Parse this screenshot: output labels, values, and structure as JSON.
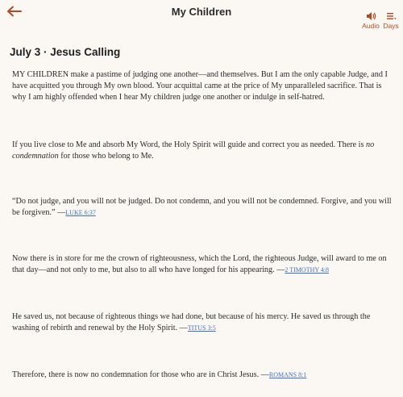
{
  "header": {
    "title": "My Children",
    "audio_label": "Audio",
    "days_label": "Days",
    "accent_color": "#b04a22"
  },
  "heading": "July 3 · Jesus Calling",
  "paragraphs": [
    {
      "text": "MY CHILDREN make a pastime of judging one another—and themselves. But I am the only capable Judge, and I have acquitted you through My own blood. Your acquittal came at the price of My unparalleled sacrifice. That is why I am highly offended when I hear My children judge one another or indulge in self-hatred."
    },
    {
      "before": "If you live close to Me and absorb My Word, the Holy Spirit will guide and correct you as needed. There is ",
      "emphasis": "no condemnation",
      "after": " for those who belong to Me."
    },
    {
      "text": "“Do not judge, and you will not be judged. Do not condemn, and you will not be condemned. Forgive, and you will be forgiven.” —",
      "ref": "LUKE 6:37"
    },
    {
      "text": "Now there is in store for me the crown of righteousness, which the Lord, the righteous Judge, will award to me on that day—and not only to me, but also to all who have longed for his appearing. —",
      "ref": "2 TIMOTHY 4:8"
    },
    {
      "text": "He saved us, not because of righteous things we had done, but because of his mercy. He saved us through the washing of rebirth and renewal by the Holy Spirit. —",
      "ref": "TITUS 3:5"
    },
    {
      "text": "Therefore, there is now no condemnation for those who are in Christ Jesus. —",
      "ref": "ROMANS 8:1"
    }
  ]
}
